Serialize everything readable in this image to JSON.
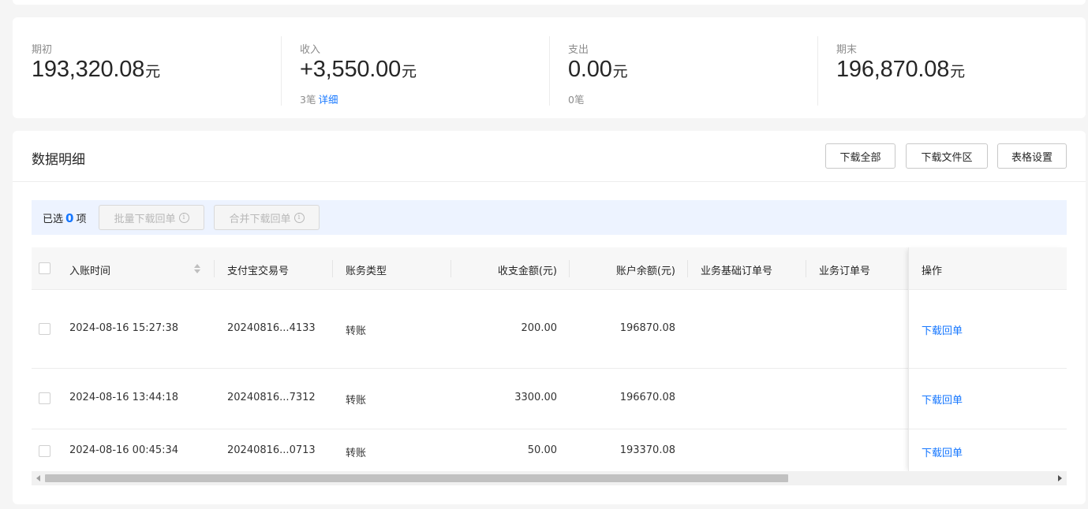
{
  "summary": {
    "opening": {
      "label": "期初",
      "value": "193,320.08",
      "unit": "元"
    },
    "income": {
      "label": "收入",
      "value": "+3,550.00",
      "unit": "元",
      "count": "3笔",
      "detail_link": "详细"
    },
    "expense": {
      "label": "支出",
      "value": "0.00",
      "unit": "元",
      "count": "0笔"
    },
    "closing": {
      "label": "期末",
      "value": "196,870.08",
      "unit": "元"
    }
  },
  "detail": {
    "title": "数据明细",
    "buttons": {
      "download_all": "下载全部",
      "download_area": "下载文件区",
      "table_settings": "表格设置"
    }
  },
  "selection": {
    "prefix": "已选",
    "count": "0",
    "suffix": "项",
    "batch_download": "批量下载回单",
    "merge_download": "合并下载回单",
    "info_glyph": "i"
  },
  "table": {
    "columns": [
      "入账时间",
      "支付宝交易号",
      "账务类型",
      "收支金额(元)",
      "账户余额(元)",
      "业务基础订单号",
      "业务订单号",
      "操作"
    ],
    "rows": [
      {
        "time": "2024-08-16 15:27:38",
        "trade_no": "20240816...4133",
        "type": "转账",
        "amount": "200.00",
        "balance": "196870.08",
        "action": "下载回单"
      },
      {
        "time": "2024-08-16 13:44:18",
        "trade_no": "20240816...7312",
        "type": "转账",
        "amount": "3300.00",
        "balance": "196670.08",
        "action": "下载回单"
      },
      {
        "time": "2024-08-16 00:45:34",
        "trade_no": "20240816...0713",
        "type": "转账",
        "amount": "50.00",
        "balance": "193370.08",
        "action": "下载回单"
      }
    ]
  },
  "colors": {
    "accent": "#1677ff",
    "text": "#262626",
    "muted": "#8c8c8c"
  }
}
